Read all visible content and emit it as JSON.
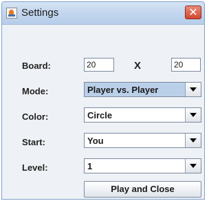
{
  "window": {
    "title": "Settings",
    "close_glyph": "✕",
    "app_icon": "java-cup-icon",
    "close_icon": "close-icon"
  },
  "form": {
    "board": {
      "label": "Board:",
      "width": "20",
      "separator": "X",
      "height": "20"
    },
    "mode": {
      "label": "Mode:",
      "value": "Player vs. Player"
    },
    "color": {
      "label": "Color:",
      "value": "Circle"
    },
    "start": {
      "label": "Start:",
      "value": "You"
    },
    "level": {
      "label": "Level:",
      "value": "1"
    }
  },
  "actions": {
    "play_and_close": "Play and Close"
  },
  "colors": {
    "titlebar": "#c4d7ef",
    "close_button": "#d2472e",
    "selected_combo": "#bacfe8",
    "window_background": "#eef1f5"
  }
}
